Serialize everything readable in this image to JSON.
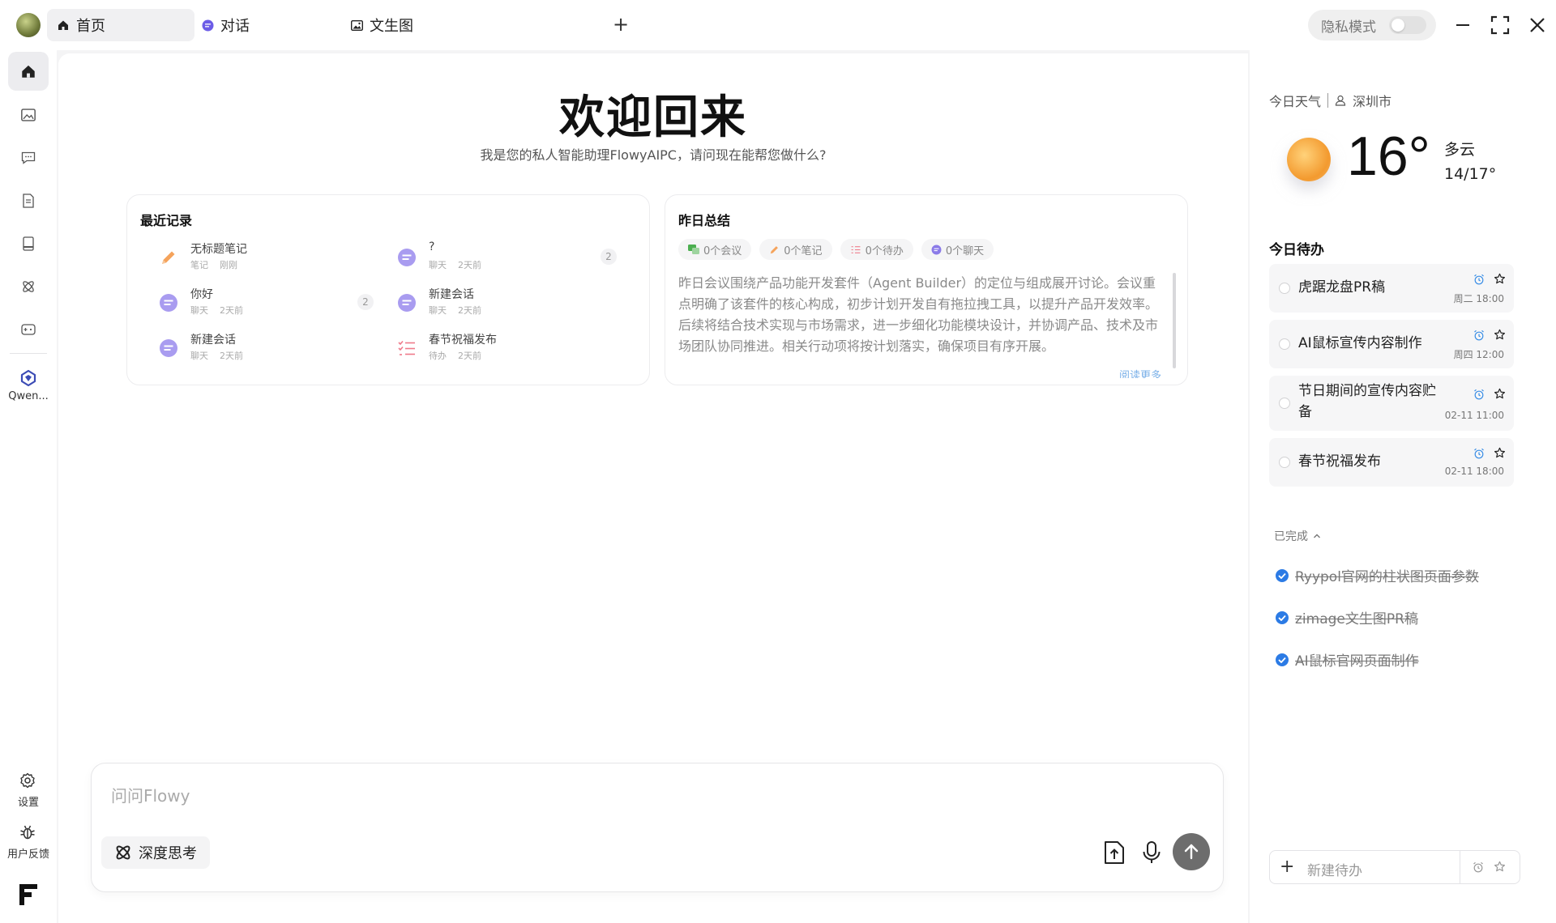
{
  "tabs": [
    {
      "label": "首页",
      "icon": "home-icon",
      "active": true
    },
    {
      "label": "对话",
      "icon": "chat-icon",
      "active": false
    },
    {
      "label": "文生图",
      "icon": "image-icon",
      "active": false
    }
  ],
  "titlebar": {
    "add_tab": "+",
    "privacy_label": "隐私模式",
    "privacy_on": false
  },
  "rail": {
    "apps": [
      {
        "label": "Qwen..."
      }
    ],
    "settings_label": "设置",
    "feedback_label": "用户反馈"
  },
  "main": {
    "welcome": "欢迎回来",
    "subtitle": "我是您的私人智能助理FlowyAIPC，请问现在能帮您做什么?",
    "recent": {
      "title": "最近记录",
      "items": [
        {
          "title": "无标题笔记",
          "type": "笔记",
          "time": "刚刚",
          "count": "",
          "icon": "pencil-icon"
        },
        {
          "title": "?",
          "type": "聊天",
          "time": "2天前",
          "count": "2",
          "icon": "chat-bubble-icon"
        },
        {
          "title": "你好",
          "type": "聊天",
          "time": "2天前",
          "count": "2",
          "icon": "chat-bubble-icon"
        },
        {
          "title": "新建会话",
          "type": "聊天",
          "time": "2天前",
          "count": "",
          "icon": "chat-bubble-icon"
        },
        {
          "title": "新建会话",
          "type": "聊天",
          "time": "2天前",
          "count": "",
          "icon": "chat-bubble-icon"
        },
        {
          "title": "春节祝福发布",
          "type": "待办",
          "time": "2天前",
          "count": "",
          "icon": "checklist-icon"
        }
      ]
    },
    "summary": {
      "title": "昨日总结",
      "chips": [
        {
          "label": "0个会议",
          "icon": "meeting-icon",
          "color": "#4caf50"
        },
        {
          "label": "0个笔记",
          "icon": "pencil-icon",
          "color": "#f5a35b"
        },
        {
          "label": "0个待办",
          "icon": "checklist-icon",
          "color": "#ef7a8a"
        },
        {
          "label": "0个聊天",
          "icon": "chat-bubble-icon",
          "color": "#8b7be8"
        }
      ],
      "text": "昨日会议围绕产品功能开发套件（Agent Builder）的定位与组成展开讨论。会议重点明确了该套件的核心构成，初步计划开发自有拖拉拽工具，以提升产品开发效率。后续将结合技术实现与市场需求，进一步细化功能模块设计，并协调产品、技术及市场团队协同推进。相关行动项将按计划落实，确保项目有序开展。",
      "read_more": "阅读更多"
    },
    "input": {
      "placeholder": "问问Flowy",
      "deep_think_label": "深度思考"
    }
  },
  "weather": {
    "label": "今日天气",
    "city": "深圳市",
    "temp": "16°",
    "condition": "多云",
    "range": "14/17°"
  },
  "todos": {
    "title": "今日待办",
    "items": [
      {
        "text": "虎踞龙盘PR稿",
        "date": "周二 18:00"
      },
      {
        "text": "AI鼠标宣传内容制作",
        "date": "周四 12:00"
      },
      {
        "text": "节日期间的宣传内容贮备",
        "date": "02-11 11:00"
      },
      {
        "text": "春节祝福发布",
        "date": "02-11 18:00"
      }
    ],
    "completed_label": "已完成",
    "completed": [
      "Ryypol官网的柱状图页面参数",
      "zimage文生图PR稿",
      "AI鼠标官网页面制作"
    ],
    "new_placeholder": "新建待办"
  },
  "colors": {
    "accent_blue": "#2c7be5",
    "alarm_blue": "#3a8ee6",
    "chat_purple": "#8b7be8",
    "pencil_orange": "#f5a35b",
    "checklist_red": "#ef7a8a"
  }
}
